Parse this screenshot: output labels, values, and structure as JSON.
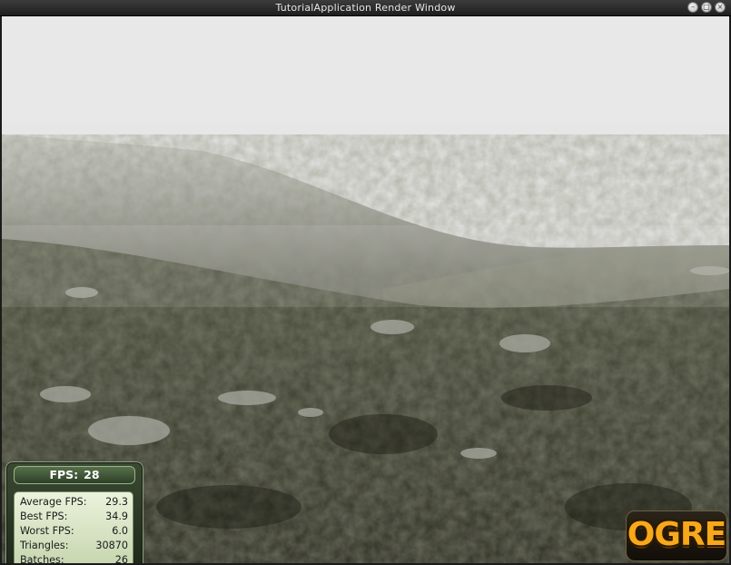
{
  "window": {
    "title": "TutorialApplication Render Window",
    "buttons": [
      "minimize",
      "maximize",
      "close"
    ]
  },
  "stats": {
    "fps_label": "FPS:",
    "fps_value": "28",
    "rows": [
      {
        "label": "Average FPS:",
        "value": "29.3"
      },
      {
        "label": "Best FPS:",
        "value": "34.9"
      },
      {
        "label": "Worst FPS:",
        "value": "6.0"
      },
      {
        "label": "Triangles:",
        "value": "30870"
      },
      {
        "label": "Batches:",
        "value": "26"
      }
    ]
  },
  "logo": {
    "text": "OGRE"
  },
  "colors": {
    "sky": "#e7e7e7",
    "terrain_dark": "#2a2b20",
    "terrain_mid": "#4d4f3d",
    "stats_panel": "#2f3f28",
    "logo_orange": "#f7a81b"
  }
}
